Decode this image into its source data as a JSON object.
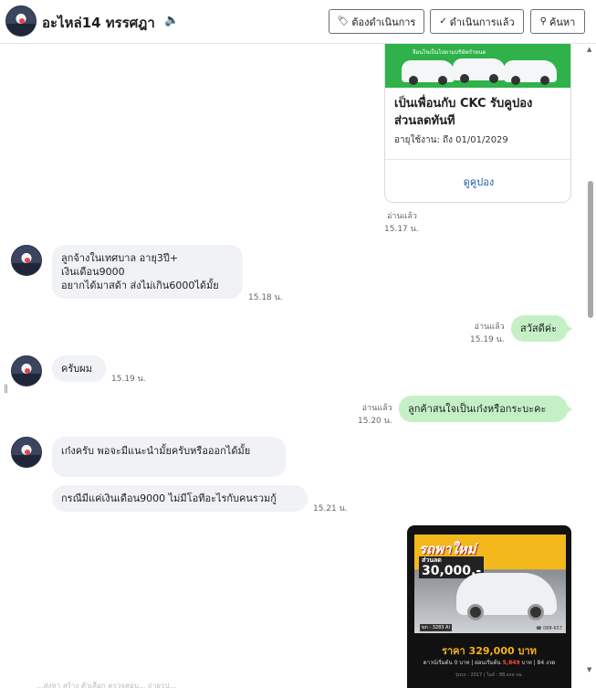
{
  "header": {
    "title": "อะไหล่14 ทรรศฎา",
    "speaker_icon": "speaker-icon",
    "buttons": [
      {
        "label": "ต้องดำเนินการ",
        "icon": "pending-icon"
      },
      {
        "label": "ดำเนินการแล้ว",
        "icon": "done-icon"
      },
      {
        "label": "ค้นหา",
        "icon": "search-icon"
      }
    ]
  },
  "card": {
    "banner_text": "จีอนไขเป็นไปตามบริษัทกำหนด",
    "title": "เป็นเพื่อนกับ CKC รับคูปองส่วนลดทันที",
    "expiry": "อายุใช้งาน: ถึง 01/01/2029",
    "link": "ดูคูปอง",
    "read": "อ่านแล้ว",
    "time": "15.17 น."
  },
  "messages": [
    {
      "side": "in",
      "lines": [
        "ลูกจ้างในเทศบาล อายุ3ปี+",
        "เงินเดือน9000",
        "อยากได้มาสด้า ส่งไม่เกิน6000ได้มั้ย"
      ],
      "time": "15.18 น."
    },
    {
      "side": "out",
      "text": "สวัสดีค่ะ",
      "read": "อ่านแล้ว",
      "time": "15.19 น."
    },
    {
      "side": "in",
      "text": "ครับผม",
      "time": "15.19 น."
    },
    {
      "side": "out",
      "text": "ลูกค้าสนใจเป็นเก๋งหรือกระบะคะ",
      "read": "อ่านแล้ว",
      "time": "15.20 น."
    },
    {
      "side": "in",
      "text": "เก๋งครับ พอจะมีแนะนำมั้ยครับหรือออกได้มั้ย"
    },
    {
      "side": "in",
      "text": "กรณีมีแค่เงินเดือน9000 ไม่มีโอทีอะไรกับคนรวมกู้",
      "time": "15.21 น."
    }
  ],
  "promo": {
    "headline": "รถพาใหม่",
    "discount_label": "ส่วนลด",
    "discount": "30,000.-",
    "plate": "ฆก - 3283 AI",
    "phone": "☎ 088-657",
    "price": "ราคา 329,000 บาท",
    "terms_pre": "ดาวน์เริ่มต้น 0 บาท | ผ่อนเริ่มต้น",
    "terms_amount": "5,849",
    "terms_post": "บาท | 84 งวด",
    "tiny": "รุ่นรถ : 2017 | ไมล์ : 88,xxx กม."
  },
  "bottom_text": "...ส่งหา สร้าง ตัวเลือก   ตรวจสอบ...   ถ่ายรูป...",
  "colors": {
    "incoming_bubble": "#f0f2f5",
    "outgoing_bubble": "#c5f0c6",
    "banner": "#2fb24a",
    "link": "#1c5aa6"
  }
}
